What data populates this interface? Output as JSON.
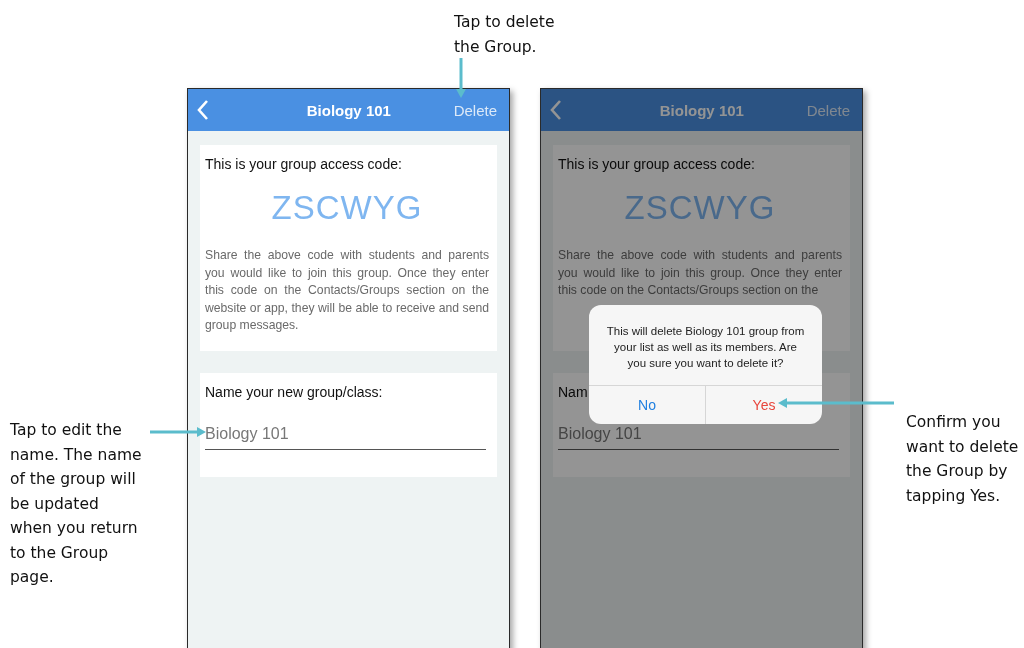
{
  "annotations": {
    "top": "Tap to delete\nthe Group.",
    "left": "Tap to edit the\nname. The name\nof the group will\nbe updated\nwhen you return\nto the Group\npage.",
    "right": "Confirm you\nwant to delete\nthe Group by\ntapping Yes."
  },
  "phones": [
    {
      "dimmed": false,
      "header": {
        "title": "Biology 101",
        "action": "Delete"
      },
      "code_card": {
        "label": "This is your group access code:",
        "code": "ZSCWYG",
        "description": "Share the above code with students and parents you would like to join this group. Once they enter this code on the Contacts/Groups section on the website or app, they will be able to receive and send group messages."
      },
      "name_card": {
        "label": "Name your new group/class:",
        "value": "Biology 101"
      }
    },
    {
      "dimmed": true,
      "header": {
        "title": "Biology 101",
        "action": "Delete"
      },
      "code_card": {
        "label": "This is your group access code:",
        "code": "ZSCWYG",
        "description": "Share the above code with students and parents you would like to join this group. Once they enter this code on the Contacts/Groups section on the"
      },
      "name_card": {
        "label": "Nam",
        "value": "Biology 101"
      },
      "dialog": {
        "message": "This will delete Biology 101 group from your list as well as its members. Are you sure you want to delete it?",
        "buttons": [
          {
            "label": "No",
            "kind": "cancel"
          },
          {
            "label": "Yes",
            "kind": "destructive"
          }
        ]
      }
    }
  ]
}
